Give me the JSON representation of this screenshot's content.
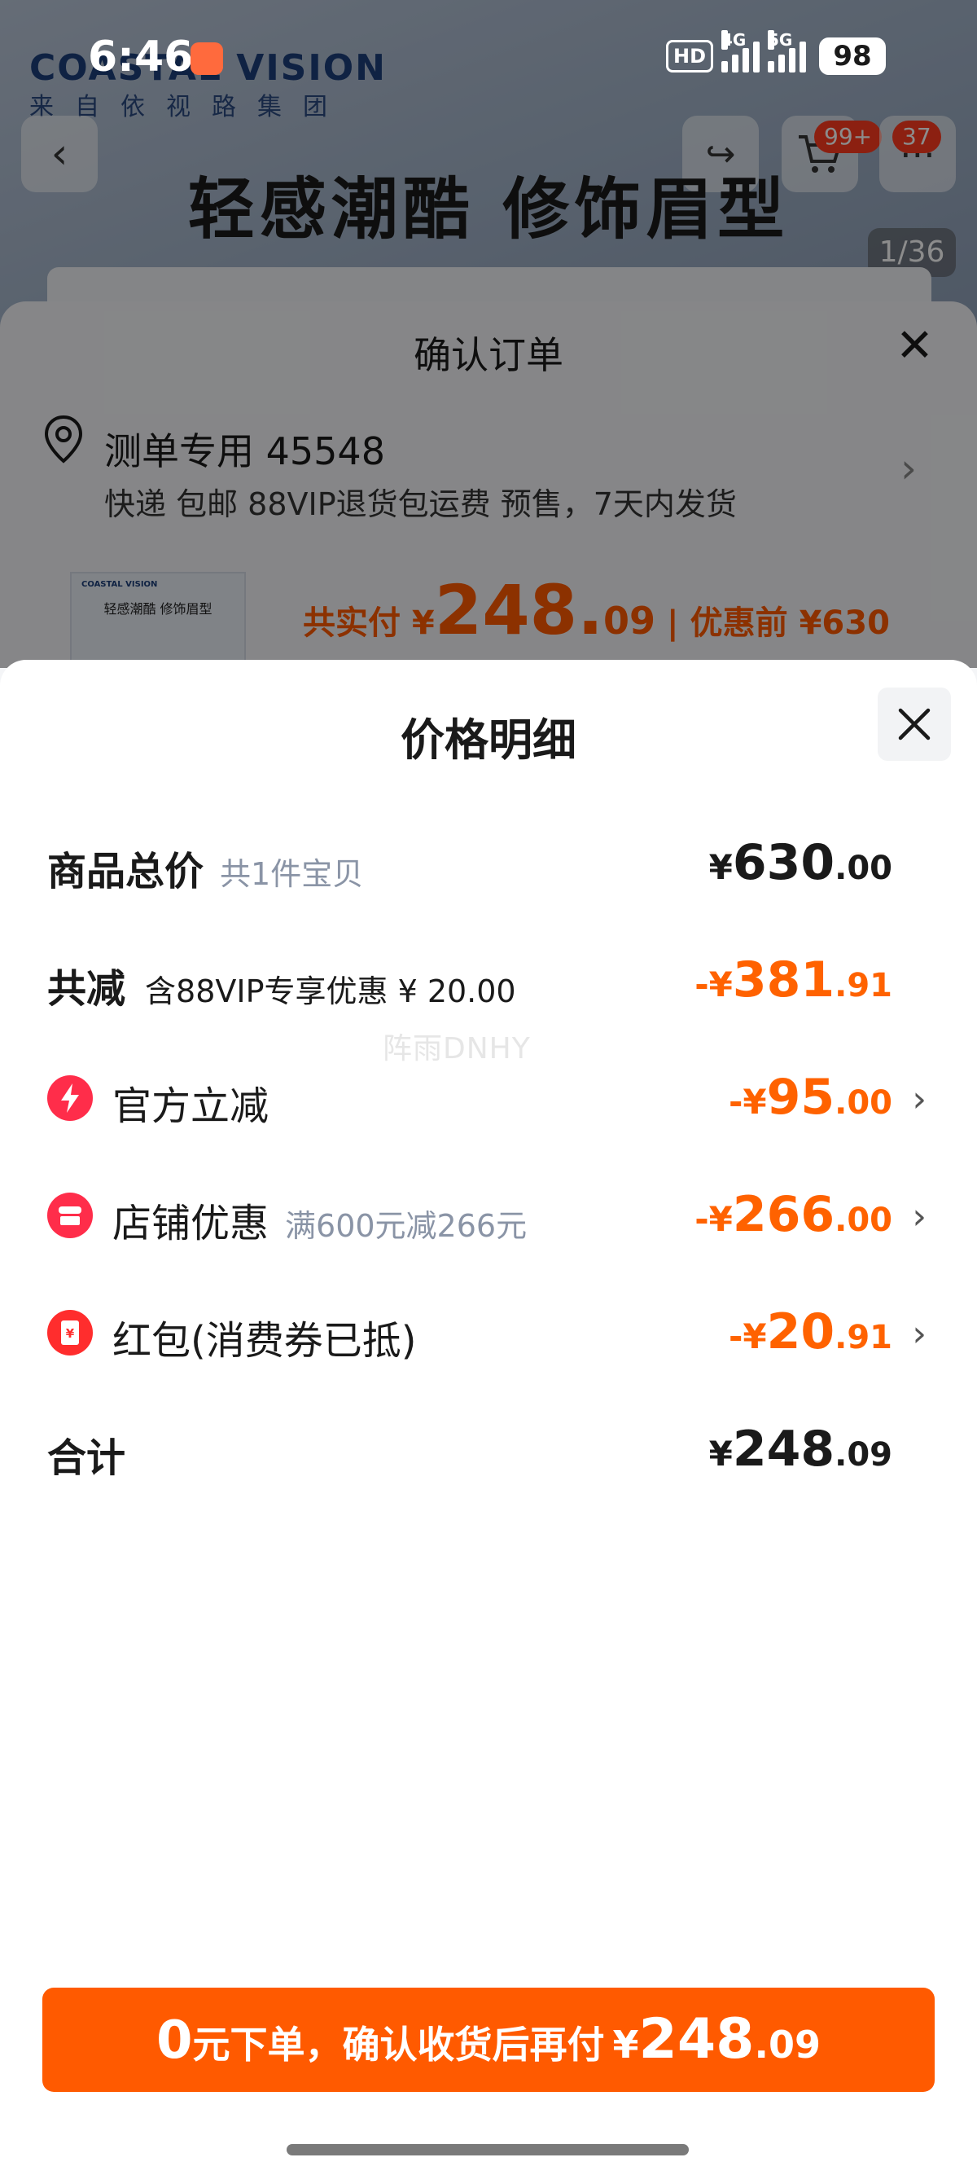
{
  "status_bar": {
    "time": "6:46",
    "hd": "HD",
    "net1": "4G",
    "net2": "5G",
    "battery": "98"
  },
  "background": {
    "brand": "COASTAL VISION",
    "brand_sub": "来自依视路集团",
    "slogan": "轻感潮酷  修饰眉型",
    "cart_badge": "99+",
    "msg_badge": "37",
    "image_counter": "1/36"
  },
  "order_sheet": {
    "title": "确认订单",
    "address_name": "测单专用 45548",
    "address_note": "快递 包邮 88VIP退货包运费 预售，7天内发货",
    "thumb_brand": "COASTAL VISION",
    "thumb_slogan": "轻感潮酷 修饰眉型",
    "total_prefix": "共实付 ¥",
    "total_int": "248.",
    "total_dec": "09",
    "total_sep": "|",
    "original": "优惠前 ¥630"
  },
  "price_detail": {
    "title": "价格明细",
    "rows": [
      {
        "label": "商品总价",
        "sub": "共1件宝贝",
        "yen": "¥",
        "int": "630",
        "dec": ".00"
      },
      {
        "label": "共减",
        "sub": "含88VIP专享优惠 ¥ 20.00",
        "yen": "-¥",
        "int": "381",
        "dec": ".91"
      },
      {
        "label": "官方立减",
        "yen": "-¥",
        "int": "95",
        "dec": ".00",
        "icon": "lightning-icon",
        "icon_color": "#ff2d4a"
      },
      {
        "label": "店铺优惠",
        "sub": "满600元减266元",
        "yen": "-¥",
        "int": "266",
        "dec": ".00",
        "icon": "shop-coupon-icon",
        "icon_color": "#ff2d4a"
      },
      {
        "label": "红包(消费券已抵)",
        "yen": "-¥",
        "int": "20",
        "dec": ".91",
        "icon": "red-envelope-icon",
        "icon_color": "#ff2d2d",
        "icon_glyph": "¥"
      },
      {
        "label": "合计",
        "yen": "¥",
        "int": "248",
        "dec": ".09"
      }
    ],
    "watermark": "阵雨DNHY",
    "colors": {
      "accent": "#ff5a00",
      "discount": "#ff6200"
    }
  },
  "pay_button": {
    "zero": "0",
    "text": "元下单，确认收货后再付",
    "yen": "¥",
    "int": "248",
    "dec": ".09"
  }
}
